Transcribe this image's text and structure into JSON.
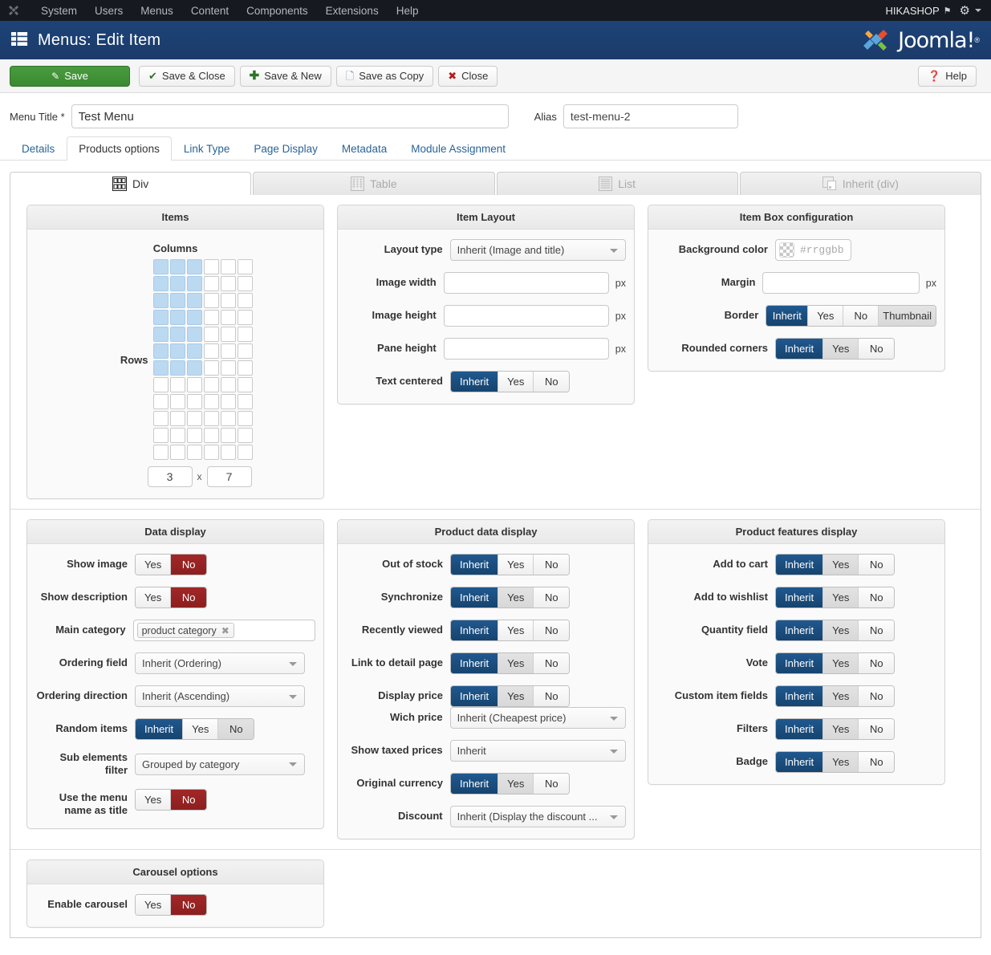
{
  "topnav": {
    "brand_icon": "joomla-brand-icon",
    "items": [
      "System",
      "Users",
      "Menus",
      "Content",
      "Components",
      "Extensions",
      "Help"
    ],
    "site_name": "HIKASHOP",
    "external_icon": "external-link-icon",
    "gear_icon": "gear-icon",
    "caret_icon": "chevron-down-icon"
  },
  "subheader": {
    "page_icon": "menu-list-icon",
    "title": "Menus: Edit Item",
    "logo_text": "Joomla!",
    "logo_reg": "®"
  },
  "toolbar": {
    "save": "Save",
    "save_close": "Save & Close",
    "save_new": "Save & New",
    "save_copy": "Save as Copy",
    "close": "Close",
    "help": "Help",
    "icons": {
      "save": "pencil-square-icon",
      "save_close": "check-icon",
      "save_new": "plus-icon",
      "save_copy": "copy-icon",
      "close": "close-circle-icon",
      "help": "question-circle-icon"
    }
  },
  "titlerow": {
    "menu_title_label": "Menu Title *",
    "menu_title_value": "Test Menu",
    "menu_title_placeholder": "",
    "alias_label": "Alias",
    "alias_value": "test-menu-2",
    "alias_placeholder": ""
  },
  "main_tabs": [
    {
      "label": "Details",
      "active": false
    },
    {
      "label": "Products options",
      "active": true
    },
    {
      "label": "Link Type",
      "active": false
    },
    {
      "label": "Page Display",
      "active": false
    },
    {
      "label": "Metadata",
      "active": false
    },
    {
      "label": "Module Assignment",
      "active": false
    }
  ],
  "layout_tabs": [
    {
      "label": "Div",
      "icon": "grid-div-icon",
      "active": true
    },
    {
      "label": "Table",
      "icon": "table-icon",
      "active": false
    },
    {
      "label": "List",
      "icon": "list-icon",
      "active": false
    },
    {
      "label": "Inherit (div)",
      "icon": "inherit-icon",
      "active": false
    }
  ],
  "items_panel": {
    "title": "Items",
    "columns_label": "Columns",
    "rows_label": "Rows",
    "grid_cols": 6,
    "grid_rows": 12,
    "selected_cols": 3,
    "selected_rows": 7,
    "cols_value": "3",
    "rows_value": "7",
    "multiplier": "x"
  },
  "item_layout": {
    "title": "Item Layout",
    "layout_type_label": "Layout type",
    "layout_type_value": "Inherit (Image and title)",
    "image_width_label": "Image width",
    "image_width_value": "",
    "image_height_label": "Image height",
    "image_height_value": "",
    "pane_height_label": "Pane height",
    "pane_height_value": "",
    "unit_px": "px",
    "text_centered_label": "Text centered",
    "text_centered_options": [
      "Inherit",
      "Yes",
      "No"
    ],
    "text_centered_selected": "Inherit"
  },
  "item_box": {
    "title": "Item Box configuration",
    "bg_color_label": "Background color",
    "bg_color_placeholder": "#rrggbb",
    "bg_color_value": "",
    "swatch_icon": "transparency-checker-swatch",
    "margin_label": "Margin",
    "margin_value": "",
    "unit_px": "px",
    "border_label": "Border",
    "border_options": [
      "Inherit",
      "Yes",
      "No",
      "Thumbnail"
    ],
    "border_selected": "Inherit",
    "border_hovered": "Thumbnail",
    "rounded_label": "Rounded corners",
    "rounded_options": [
      "Inherit",
      "Yes",
      "No"
    ],
    "rounded_selected": "Inherit",
    "rounded_hovered": "Yes"
  },
  "data_display": {
    "title": "Data display",
    "show_image_label": "Show image",
    "show_image_options": [
      "Yes",
      "No"
    ],
    "show_image_selected": "No",
    "show_description_label": "Show description",
    "show_description_options": [
      "Yes",
      "No"
    ],
    "show_description_selected": "No",
    "main_category_label": "Main category",
    "main_category_chip": "product category",
    "chip_remove_icon": "remove-tag-icon",
    "ordering_field_label": "Ordering field",
    "ordering_field_value": "Inherit (Ordering)",
    "ordering_direction_label": "Ordering direction",
    "ordering_direction_value": "Inherit (Ascending)",
    "random_items_label": "Random items",
    "random_items_options": [
      "Inherit",
      "Yes",
      "No"
    ],
    "random_items_selected": "Inherit",
    "random_items_hovered": "No",
    "sub_elements_label": "Sub elements filter",
    "sub_elements_value": "Grouped by category",
    "menu_name_title_label": "Use the menu name as title",
    "menu_name_title_label_l1": "Use the menu",
    "menu_name_title_label_l2": "name as title",
    "menu_name_title_options": [
      "Yes",
      "No"
    ],
    "menu_name_title_selected": "No"
  },
  "product_data_display": {
    "title": "Product data display",
    "toggle_options": [
      "Inherit",
      "Yes",
      "No"
    ],
    "rows": [
      {
        "label": "Out of stock",
        "selected": "Inherit",
        "hovered": ""
      },
      {
        "label": "Synchronize",
        "selected": "Inherit",
        "hovered": "Yes"
      },
      {
        "label": "Recently viewed",
        "selected": "Inherit",
        "hovered": ""
      },
      {
        "label": "Link to detail page",
        "selected": "Inherit",
        "hovered": "Yes"
      },
      {
        "label": "Display price",
        "selected": "Inherit",
        "hovered": "Yes"
      }
    ],
    "which_price_label": "Wich price",
    "which_price_value": "Inherit (Cheapest price)",
    "taxed_prices_label": "Show taxed prices",
    "taxed_prices_value": "Inherit",
    "original_currency_label": "Original currency",
    "original_currency_selected": "Inherit",
    "original_currency_hovered": "Yes",
    "discount_label": "Discount",
    "discount_value": "Inherit (Display the discount ..."
  },
  "product_features_display": {
    "title": "Product features display",
    "toggle_options": [
      "Inherit",
      "Yes",
      "No"
    ],
    "rows": [
      {
        "label": "Add to cart",
        "selected": "Inherit",
        "hovered": "Yes"
      },
      {
        "label": "Add to wishlist",
        "selected": "Inherit",
        "hovered": "Yes"
      },
      {
        "label": "Quantity field",
        "selected": "Inherit",
        "hovered": "Yes"
      },
      {
        "label": "Vote",
        "selected": "Inherit",
        "hovered": "Yes"
      },
      {
        "label": "Custom item fields",
        "selected": "Inherit",
        "hovered": "Yes"
      },
      {
        "label": "Filters",
        "selected": "Inherit",
        "hovered": "Yes"
      },
      {
        "label": "Badge",
        "selected": "Inherit",
        "hovered": "Yes"
      }
    ]
  },
  "carousel": {
    "title": "Carousel options",
    "enable_label": "Enable carousel",
    "enable_options": [
      "Yes",
      "No"
    ],
    "enable_selected": "No"
  },
  "colors": {
    "topnav_bg": "#16191f",
    "subheader_bg": "#1c3f71",
    "accent_blue": "#20588f",
    "accent_red": "#a22727",
    "save_green": "#4a9c3f",
    "grid_selected": "#bcd9f2"
  }
}
